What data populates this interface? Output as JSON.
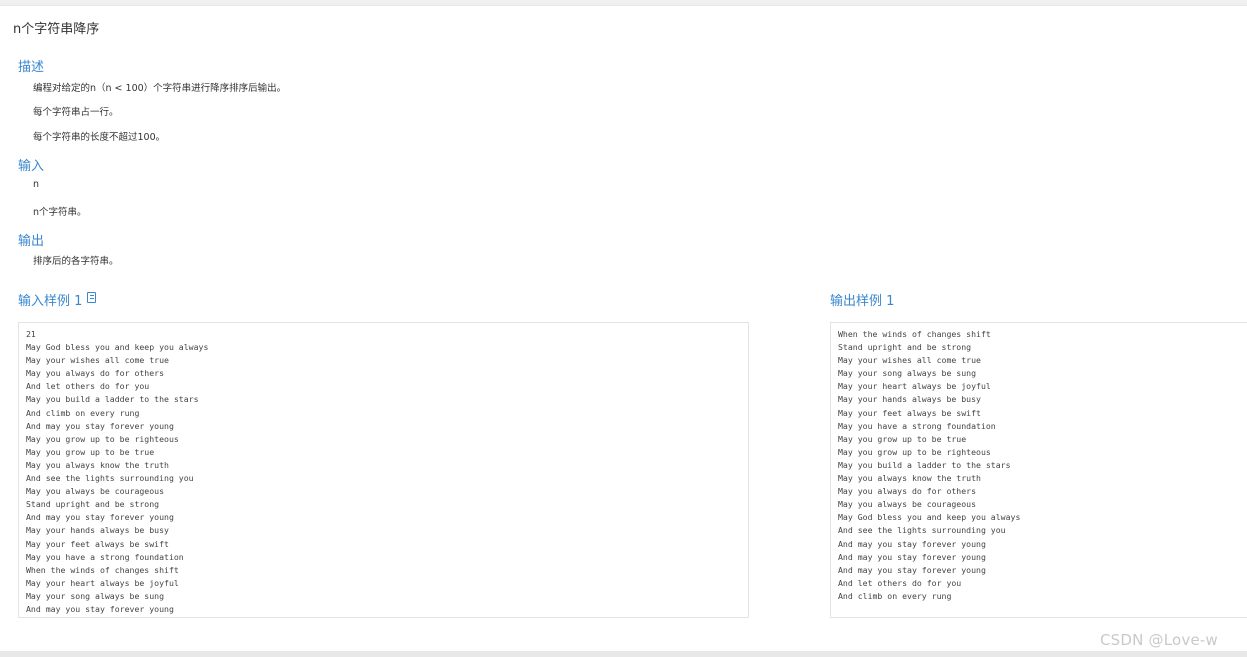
{
  "problem": {
    "title": "n个字符串降序"
  },
  "description": {
    "heading": "描述",
    "lines": [
      "编程对给定的n（n < 100）个字符串进行降序排序后输出。",
      "每个字符串占一行。",
      "每个字符串的长度不超过100。"
    ]
  },
  "input": {
    "heading": "输入",
    "lines": [
      "n",
      "n个字符串。"
    ]
  },
  "output": {
    "heading": "输出",
    "lines": [
      "排序后的各字符串。"
    ]
  },
  "sample_input": {
    "heading": "输入样例 1",
    "copy_icon": "copy-icon",
    "text": "21\nMay God bless you and keep you always\nMay your wishes all come true\nMay you always do for others\nAnd let others do for you\nMay you build a ladder to the stars\nAnd climb on every rung\nAnd may you stay forever young\nMay you grow up to be righteous\nMay you grow up to be true\nMay you always know the truth\nAnd see the lights surrounding you\nMay you always be courageous\nStand upright and be strong\nAnd may you stay forever young\nMay your hands always be busy\nMay your feet always be swift\nMay you have a strong foundation\nWhen the winds of changes shift\nMay your heart always be joyful\nMay your song always be sung\nAnd may you stay forever young"
  },
  "sample_output": {
    "heading": "输出样例 1",
    "text": "When the winds of changes shift\nStand upright and be strong\nMay your wishes all come true\nMay your song always be sung\nMay your heart always be joyful\nMay your hands always be busy\nMay your feet always be swift\nMay you have a strong foundation\nMay you grow up to be true\nMay you grow up to be righteous\nMay you build a ladder to the stars\nMay you always know the truth\nMay you always do for others\nMay you always be courageous\nMay God bless you and keep you always\nAnd see the lights surrounding you\nAnd may you stay forever young\nAnd may you stay forever young\nAnd may you stay forever young\nAnd let others do for you\nAnd climb on every rung"
  },
  "watermark": "CSDN @Love-w",
  "colors": {
    "accent": "#3a87ce",
    "text": "#333333",
    "border": "#e3e3e3"
  }
}
